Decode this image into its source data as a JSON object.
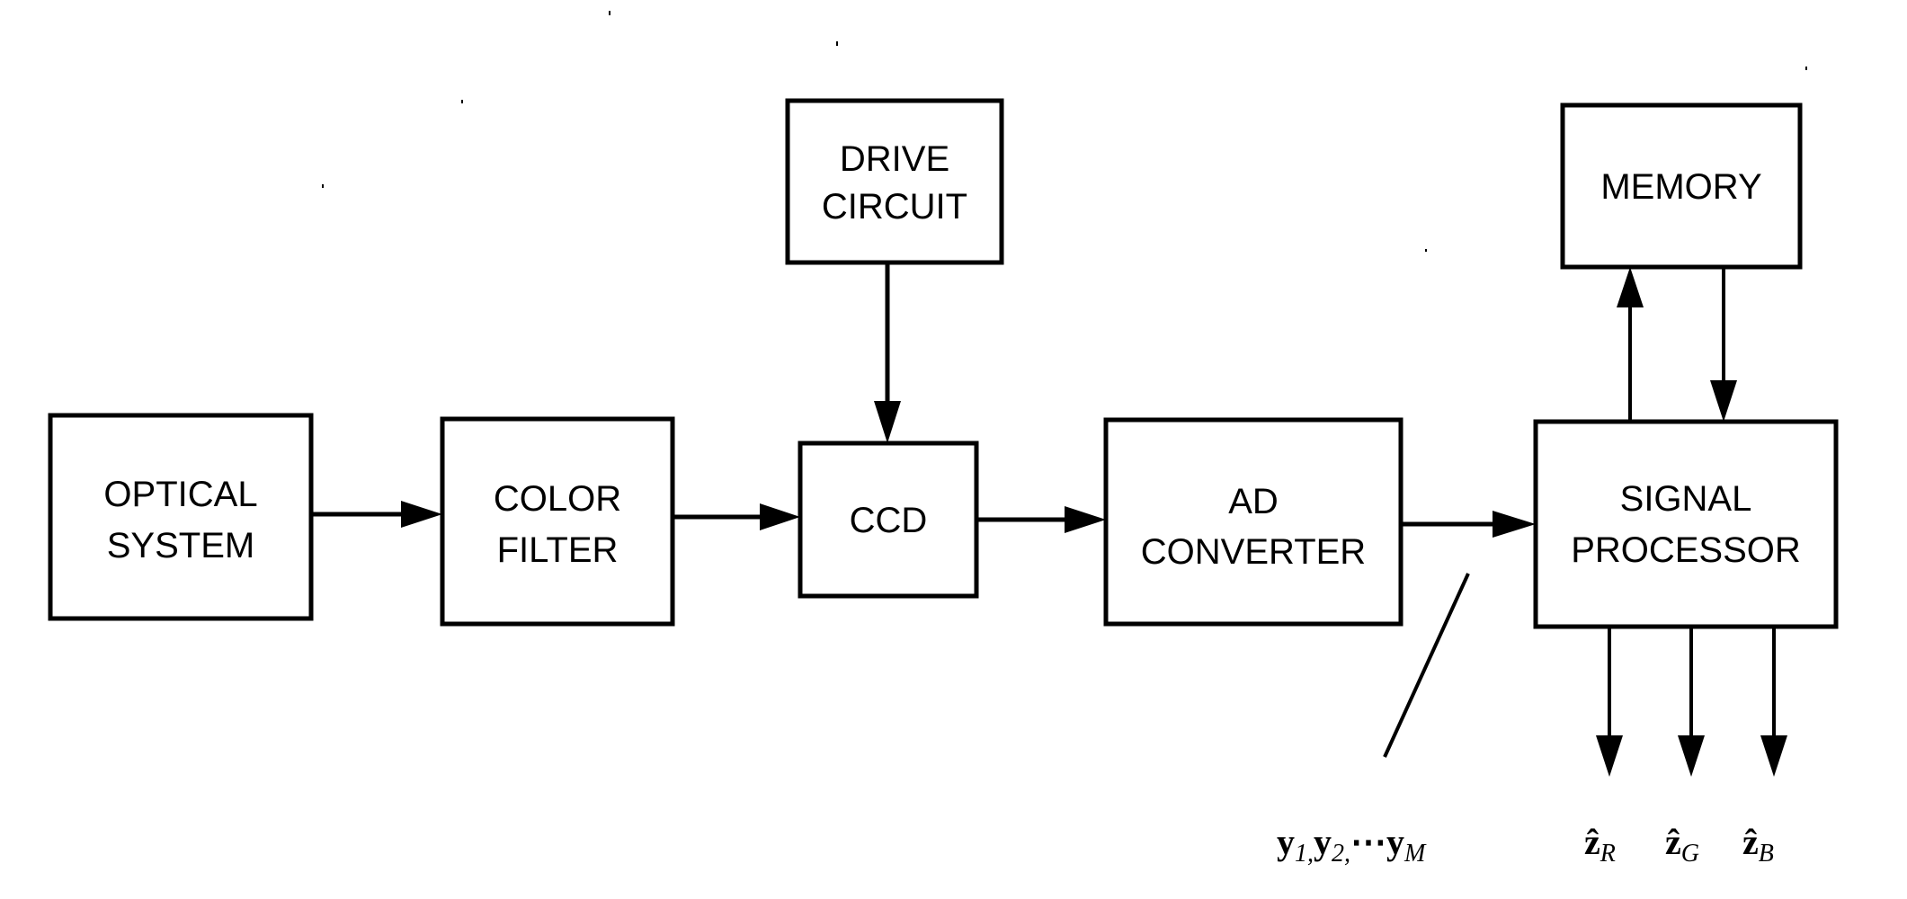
{
  "diagram": {
    "type": "block-diagram",
    "blocks": {
      "optical_system": {
        "lines": [
          "OPTICAL",
          "SYSTEM"
        ]
      },
      "color_filter": {
        "lines": [
          "COLOR",
          "FILTER"
        ]
      },
      "ccd": {
        "lines": [
          "CCD"
        ]
      },
      "drive_circuit": {
        "lines": [
          "DRIVE",
          "CIRCUIT"
        ]
      },
      "ad_converter": {
        "lines": [
          "AD",
          "CONVERTER"
        ]
      },
      "memory": {
        "lines": [
          "MEMORY"
        ]
      },
      "signal_processor": {
        "lines": [
          "SIGNAL",
          "PROCESSOR"
        ]
      }
    },
    "connections": [
      {
        "from": "optical_system",
        "to": "color_filter"
      },
      {
        "from": "color_filter",
        "to": "ccd"
      },
      {
        "from": "drive_circuit",
        "to": "ccd"
      },
      {
        "from": "ccd",
        "to": "ad_converter"
      },
      {
        "from": "ad_converter",
        "to": "signal_processor"
      },
      {
        "from": "signal_processor",
        "to": "memory"
      },
      {
        "from": "memory",
        "to": "signal_processor"
      },
      {
        "from": "signal_processor",
        "to": "output_r"
      },
      {
        "from": "signal_processor",
        "to": "output_g"
      },
      {
        "from": "signal_processor",
        "to": "output_b"
      }
    ],
    "signal_label": {
      "y1": "y",
      "y1_sub": "1,",
      "y2": "y",
      "y2_sub": "2,",
      "ellipsis": "⋯",
      "yM": "y",
      "yM_sub": "M"
    },
    "output_labels": [
      {
        "symbol": "ẑ",
        "sub": "R"
      },
      {
        "symbol": "ẑ",
        "sub": "G"
      },
      {
        "symbol": "ẑ",
        "sub": "B"
      }
    ]
  }
}
